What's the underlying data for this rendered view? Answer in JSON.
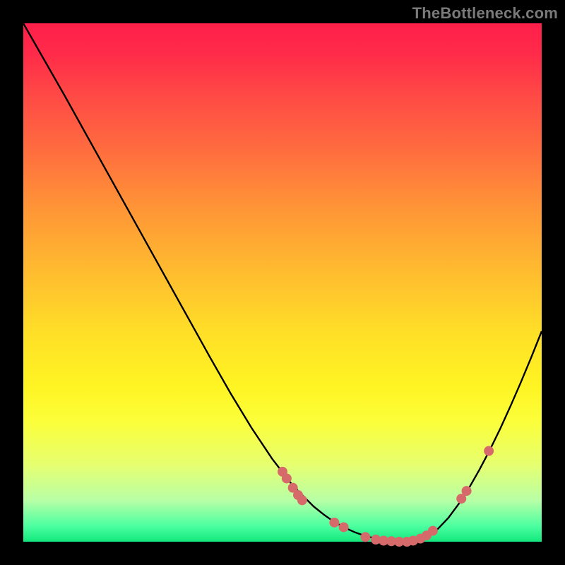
{
  "watermark": "TheBottleneck.com",
  "colors": {
    "curve": "#000000",
    "dot_fill": "#d66a6a",
    "dot_stroke": "#c65555"
  },
  "chart_data": {
    "type": "line",
    "title": "",
    "xlabel": "",
    "ylabel": "",
    "x": [
      0.0,
      0.04,
      0.08,
      0.12,
      0.16,
      0.2,
      0.24,
      0.28,
      0.32,
      0.36,
      0.4,
      0.44,
      0.48,
      0.52,
      0.56,
      0.58,
      0.6,
      0.62,
      0.64,
      0.66,
      0.68,
      0.7,
      0.72,
      0.74,
      0.76,
      0.78,
      0.8,
      0.82,
      0.84,
      0.86,
      0.88,
      0.9,
      0.92,
      0.94,
      0.96,
      0.98,
      1.0
    ],
    "values": [
      1.0,
      0.93,
      0.86,
      0.788,
      0.716,
      0.644,
      0.572,
      0.5,
      0.428,
      0.356,
      0.286,
      0.22,
      0.16,
      0.108,
      0.068,
      0.052,
      0.038,
      0.027,
      0.018,
      0.011,
      0.006,
      0.003,
      0.001,
      0.0,
      0.002,
      0.01,
      0.025,
      0.046,
      0.073,
      0.104,
      0.139,
      0.177,
      0.218,
      0.262,
      0.308,
      0.356,
      0.406
    ],
    "xlim": [
      0,
      1
    ],
    "ylim": [
      0,
      1
    ],
    "highlighted_points": [
      {
        "x": 0.5,
        "y": 0.135
      },
      {
        "x": 0.508,
        "y": 0.122
      },
      {
        "x": 0.52,
        "y": 0.104
      },
      {
        "x": 0.53,
        "y": 0.09
      },
      {
        "x": 0.538,
        "y": 0.08
      },
      {
        "x": 0.6,
        "y": 0.037
      },
      {
        "x": 0.618,
        "y": 0.028
      },
      {
        "x": 0.66,
        "y": 0.009
      },
      {
        "x": 0.68,
        "y": 0.004
      },
      {
        "x": 0.695,
        "y": 0.002
      },
      {
        "x": 0.71,
        "y": 0.001
      },
      {
        "x": 0.725,
        "y": 0.0
      },
      {
        "x": 0.74,
        "y": 0.0
      },
      {
        "x": 0.752,
        "y": 0.002
      },
      {
        "x": 0.766,
        "y": 0.006
      },
      {
        "x": 0.778,
        "y": 0.012
      },
      {
        "x": 0.79,
        "y": 0.021
      },
      {
        "x": 0.845,
        "y": 0.083
      },
      {
        "x": 0.855,
        "y": 0.098
      },
      {
        "x": 0.898,
        "y": 0.175
      }
    ],
    "dot_radius_px": 7
  }
}
